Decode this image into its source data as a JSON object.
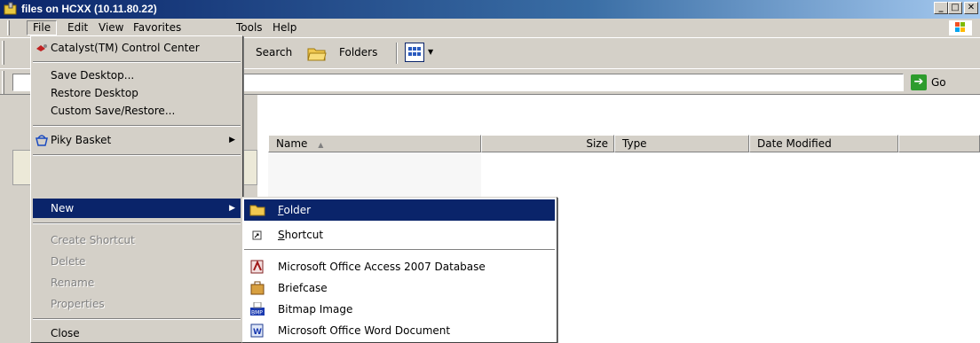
{
  "window": {
    "title": "files on HCXX (10.11.80.22)",
    "min_label": "_",
    "max_label": "□",
    "close_label": "✕"
  },
  "menubar": {
    "items": [
      "File",
      "Edit",
      "View",
      "Favorites",
      "Tools",
      "Help"
    ]
  },
  "toolbar": {
    "search_label": "Search",
    "folders_label": "Folders"
  },
  "address": {
    "value": "",
    "go_label": "Go"
  },
  "filelist": {
    "columns": [
      "Name",
      "Size",
      "Type",
      "Date Modified"
    ],
    "sort_indicator": "▲"
  },
  "file_menu": {
    "items": [
      {
        "label": "Catalyst(TM) Control Center",
        "icon": "catalyst-icon",
        "enabled": true
      },
      {
        "label": "Save Desktop...",
        "enabled": true
      },
      {
        "label": "Restore Desktop",
        "enabled": true
      },
      {
        "label": "Custom Save/Restore...",
        "enabled": true
      },
      {
        "label": "Piky Basket",
        "icon": "basket-icon",
        "enabled": true,
        "submenu": true
      },
      {
        "label": "New",
        "enabled": true,
        "submenu": true,
        "highlighted": true
      },
      {
        "label": "Create Shortcut",
        "enabled": false
      },
      {
        "label": "Delete",
        "enabled": false
      },
      {
        "label": "Rename",
        "enabled": false
      },
      {
        "label": "Properties",
        "enabled": false
      },
      {
        "label": "Close",
        "enabled": true
      }
    ]
  },
  "new_menu": {
    "items": [
      {
        "label_accel": "F",
        "label_rest": "older",
        "icon": "folder-icon",
        "highlighted": true
      },
      {
        "label_accel": "S",
        "label_rest": "hortcut",
        "icon": "shortcut-icon"
      },
      {
        "label": "Microsoft Office Access 2007 Database",
        "icon": "access-icon"
      },
      {
        "label": "Briefcase",
        "icon": "briefcase-icon"
      },
      {
        "label": "Bitmap Image",
        "icon": "bitmap-icon"
      },
      {
        "label": "Microsoft Office Word Document",
        "icon": "word-icon"
      }
    ]
  },
  "colors": {
    "highlight": "#0a246a",
    "title_gradient_start": "#0a246a",
    "title_gradient_end": "#a6caf0",
    "face": "#d4d0c8"
  }
}
